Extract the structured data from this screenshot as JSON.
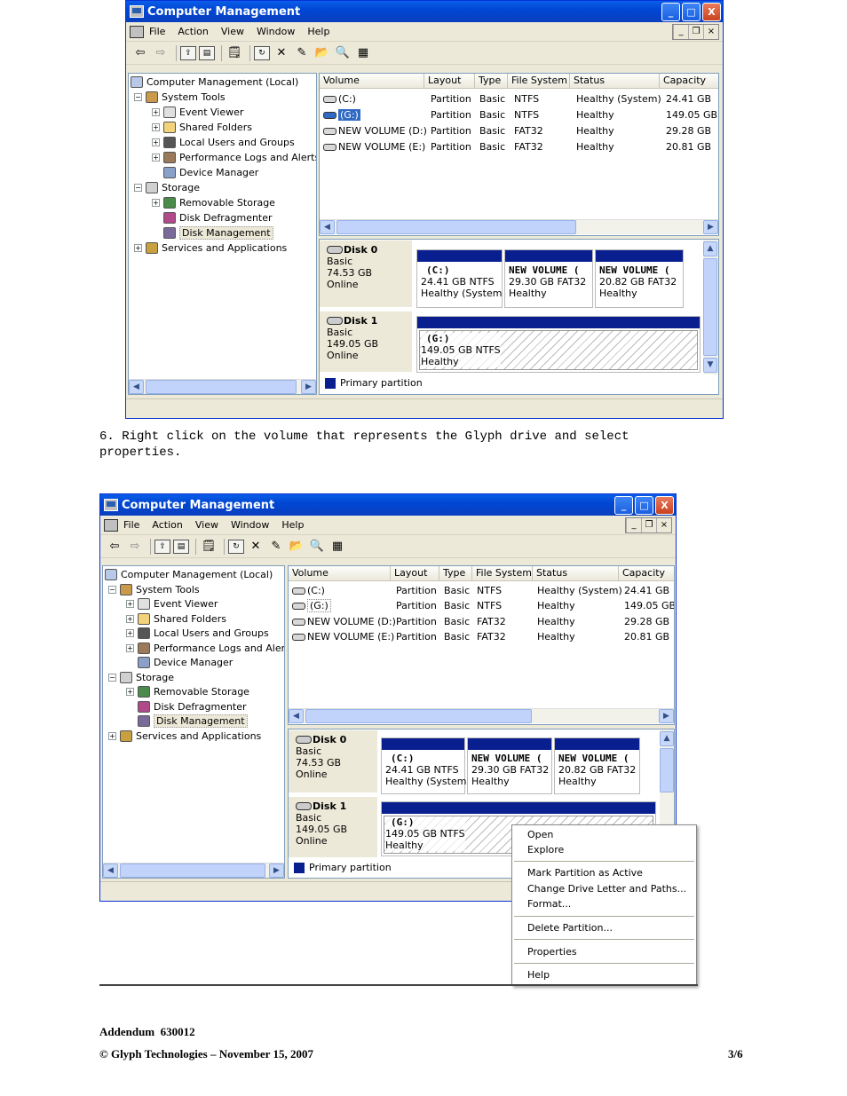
{
  "window": {
    "title": "Computer Management",
    "minimize": "_",
    "maximize": "□",
    "close": "X"
  },
  "menu": [
    "File",
    "Action",
    "View",
    "Window",
    "Help"
  ],
  "mdi_controls": [
    "_",
    "Ł",
    "X"
  ],
  "tree": {
    "root": "Computer Management (Local)",
    "system_tools": "System Tools",
    "event_viewer": "Event Viewer",
    "shared_folders": "Shared Folders",
    "local_users": "Local Users and Groups",
    "perf_logs": "Performance Logs and Alerts",
    "device_manager": "Device Manager",
    "storage": "Storage",
    "removable_storage": "Removable Storage",
    "disk_defrag": "Disk Defragmenter",
    "disk_mgmt": "Disk Management",
    "services": "Services and Applications"
  },
  "columns": [
    "Volume",
    "Layout",
    "Type",
    "File System",
    "Status",
    "Capacity"
  ],
  "volumes": [
    {
      "volume": "(C:)",
      "layout": "Partition",
      "type": "Basic",
      "fs": "NTFS",
      "status": "Healthy (System)",
      "capacity": "24.41 GB"
    },
    {
      "volume": "(G:)",
      "layout": "Partition",
      "type": "Basic",
      "fs": "NTFS",
      "status": "Healthy",
      "capacity": "149.05 GB"
    },
    {
      "volume": "NEW VOLUME (D:)",
      "layout": "Partition",
      "type": "Basic",
      "fs": "FAT32",
      "status": "Healthy",
      "capacity": "29.28 GB"
    },
    {
      "volume": "NEW VOLUME (E:)",
      "layout": "Partition",
      "type": "Basic",
      "fs": "FAT32",
      "status": "Healthy",
      "capacity": "20.81 GB"
    }
  ],
  "disk0": {
    "name": "Disk 0",
    "type": "Basic",
    "size": "74.53 GB",
    "state": "Online",
    "parts": [
      {
        "name": "(C:)",
        "size": "24.41 GB NTFS",
        "status": "Healthy (System"
      },
      {
        "name": "NEW VOLUME (",
        "size": "29.30 GB FAT32",
        "status": "Healthy"
      },
      {
        "name": "NEW VOLUME (",
        "size": "20.82 GB FAT32",
        "status": "Healthy"
      }
    ]
  },
  "disk1": {
    "name": "Disk 1",
    "type": "Basic",
    "size": "149.05 GB",
    "state": "Online",
    "part": {
      "name": "(G:)",
      "size": "149.05 GB NTFS",
      "status": "Healthy"
    }
  },
  "legend": "Primary partition",
  "instruction": "6. Right click on the volume that represents the Glyph drive and select\nproperties.",
  "context_menu": [
    "Open",
    "Explore",
    "Mark Partition as Active",
    "Change Drive Letter and Paths...",
    "Format...",
    "Delete Partition...",
    "Properties",
    "Help"
  ],
  "footer": {
    "addendum": "Addendum  630012",
    "copyright": "© Glyph Technologies – November 15, 2007",
    "page": "3/6"
  }
}
